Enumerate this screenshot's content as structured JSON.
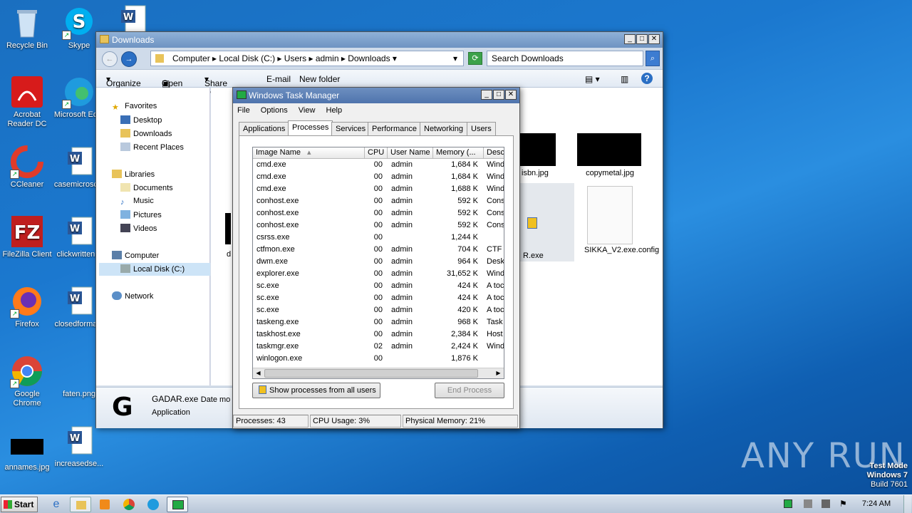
{
  "desktop": {
    "icons": [
      {
        "label": "Recycle Bin"
      },
      {
        "label": "Skype"
      },
      {
        "label": "Acrobat Reader DC"
      },
      {
        "label": "Microsoft Ed..."
      },
      {
        "label": "CCleaner"
      },
      {
        "label": "casemicrosc..."
      },
      {
        "label": "FileZilla Client"
      },
      {
        "label": "clickwritten..."
      },
      {
        "label": "Firefox"
      },
      {
        "label": "closedforma..."
      },
      {
        "label": "Google Chrome"
      },
      {
        "label": "faten.png"
      },
      {
        "label": "annames.jpg"
      },
      {
        "label": "increasedse..."
      }
    ],
    "watermark": "ANY RUN",
    "test_mode": {
      "line1": "Test Mode",
      "line2": "Windows 7",
      "line3": "Build 7601"
    }
  },
  "explorer": {
    "title": "Downloads",
    "breadcrumb": [
      "Computer",
      "Local Disk (C:)",
      "Users",
      "admin",
      "Downloads"
    ],
    "search_placeholder": "Search Downloads",
    "toolbar": {
      "organize": "Organize",
      "open": "Open",
      "share_with": "Share with",
      "email": "E-mail",
      "new_folder": "New folder"
    },
    "nav": {
      "favorites": "Favorites",
      "desktop": "Desktop",
      "downloads": "Downloads",
      "recent": "Recent Places",
      "libraries": "Libraries",
      "documents": "Documents",
      "music": "Music",
      "pictures": "Pictures",
      "videos": "Videos",
      "computer": "Computer",
      "local_disk": "Local Disk (C:)",
      "network": "Network"
    },
    "files": [
      {
        "name": "isbn.jpg"
      },
      {
        "name": "copymetal.jpg"
      },
      {
        "name": "R.exe"
      },
      {
        "name": "SIKKA_V2.exe.config"
      }
    ],
    "details": {
      "name": "GADAR.exe",
      "date_label": "Date mo",
      "type": "Application"
    }
  },
  "task_manager": {
    "title": "Windows Task Manager",
    "menu": [
      "File",
      "Options",
      "View",
      "Help"
    ],
    "tabs": [
      "Applications",
      "Processes",
      "Services",
      "Performance",
      "Networking",
      "Users"
    ],
    "active_tab": "Processes",
    "columns": {
      "image": "Image Name",
      "cpu": "CPU",
      "user": "User Name",
      "memory": "Memory (...",
      "desc": "Desc"
    },
    "processes": [
      {
        "image": "cmd.exe",
        "cpu": "00",
        "user": "admin",
        "mem": "1,684 K",
        "desc": "Wind"
      },
      {
        "image": "cmd.exe",
        "cpu": "00",
        "user": "admin",
        "mem": "1,684 K",
        "desc": "Wind"
      },
      {
        "image": "cmd.exe",
        "cpu": "00",
        "user": "admin",
        "mem": "1,688 K",
        "desc": "Wind"
      },
      {
        "image": "conhost.exe",
        "cpu": "00",
        "user": "admin",
        "mem": "592 K",
        "desc": "Cons"
      },
      {
        "image": "conhost.exe",
        "cpu": "00",
        "user": "admin",
        "mem": "592 K",
        "desc": "Cons"
      },
      {
        "image": "conhost.exe",
        "cpu": "00",
        "user": "admin",
        "mem": "592 K",
        "desc": "Cons"
      },
      {
        "image": "csrss.exe",
        "cpu": "00",
        "user": "",
        "mem": "1,244 K",
        "desc": ""
      },
      {
        "image": "ctfmon.exe",
        "cpu": "00",
        "user": "admin",
        "mem": "704 K",
        "desc": "CTF I"
      },
      {
        "image": "dwm.exe",
        "cpu": "00",
        "user": "admin",
        "mem": "964 K",
        "desc": "Desk"
      },
      {
        "image": "explorer.exe",
        "cpu": "00",
        "user": "admin",
        "mem": "31,652 K",
        "desc": "Wind"
      },
      {
        "image": "sc.exe",
        "cpu": "00",
        "user": "admin",
        "mem": "424 K",
        "desc": "A toc"
      },
      {
        "image": "sc.exe",
        "cpu": "00",
        "user": "admin",
        "mem": "424 K",
        "desc": "A toc"
      },
      {
        "image": "sc.exe",
        "cpu": "00",
        "user": "admin",
        "mem": "420 K",
        "desc": "A toc"
      },
      {
        "image": "taskeng.exe",
        "cpu": "00",
        "user": "admin",
        "mem": "968 K",
        "desc": "Task"
      },
      {
        "image": "taskhost.exe",
        "cpu": "00",
        "user": "admin",
        "mem": "2,384 K",
        "desc": "Host"
      },
      {
        "image": "taskmgr.exe",
        "cpu": "02",
        "user": "admin",
        "mem": "2,424 K",
        "desc": "Wind"
      },
      {
        "image": "winlogon.exe",
        "cpu": "00",
        "user": "",
        "mem": "1,876 K",
        "desc": ""
      }
    ],
    "show_all_button": "Show processes from all users",
    "end_process_button": "End Process",
    "status": {
      "processes": "Processes: 43",
      "cpu": "CPU Usage: 3%",
      "memory": "Physical Memory: 21%"
    }
  },
  "taskbar": {
    "start": "Start",
    "clock": "7:24 AM"
  }
}
